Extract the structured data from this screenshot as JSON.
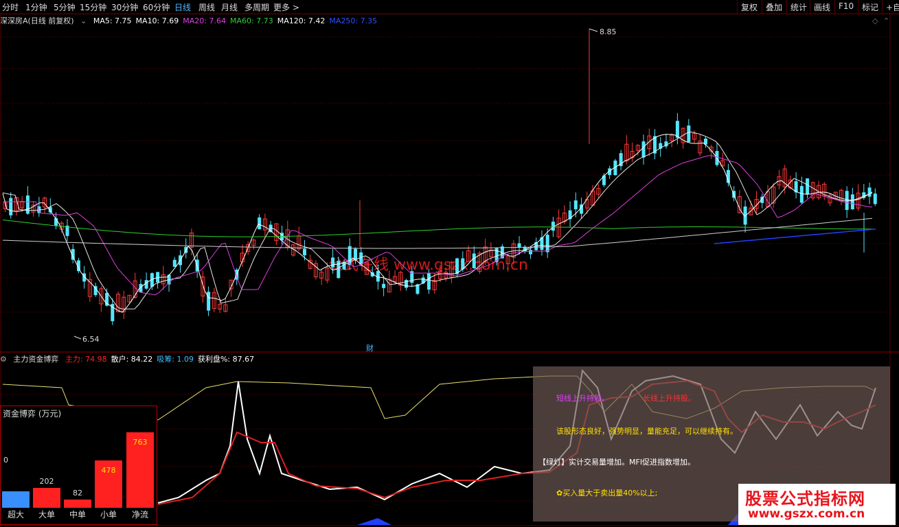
{
  "toolbar": {
    "periods": [
      "分时",
      "1分钟",
      "5分钟",
      "15分钟",
      "30分钟",
      "60分钟",
      "日线",
      "周线",
      "月线",
      "多周期",
      "更多 >"
    ],
    "active_period": "日线",
    "right_buttons": [
      "复权",
      "叠加",
      "统计",
      "画线",
      "F10",
      "标记",
      "+自"
    ]
  },
  "main_header": {
    "stock": "深深房A(日线 前复权)",
    "indicators": [
      {
        "label": "MA5: 7.75",
        "color": "#ffffff"
      },
      {
        "label": "MA10: 7.69",
        "color": "#ffffff"
      },
      {
        "label": "MA20: 7.64",
        "color": "#e040e0"
      },
      {
        "label": "MA60: 7.73",
        "color": "#30d030"
      },
      {
        "label": "MA120: 7.42",
        "color": "#ffffff"
      },
      {
        "label": "MA250: 7.35",
        "color": "#3050ff"
      }
    ]
  },
  "chart_annotations": {
    "high": "8.85",
    "low": "6.54",
    "marker": "财"
  },
  "sub_header": {
    "title": "主力资金博弈",
    "values": [
      {
        "label": "主力: 74.98",
        "color": "#ff2020"
      },
      {
        "label": "散户: 84.22",
        "color": "#ffffff"
      },
      {
        "label": "吸筹: 1.09",
        "color": "#40c0ff"
      },
      {
        "label": "获利盘%: 87.67",
        "color": "#ffffff"
      }
    ]
  },
  "fund_panel": {
    "title": "资金博弈 (万元)",
    "bars": [
      {
        "label": "超大",
        "value": 0,
        "color": "#3a8fff"
      },
      {
        "label": "大单",
        "value": 202,
        "color": "#ff2020"
      },
      {
        "label": "中单",
        "value": 82,
        "color": "#ff2020"
      },
      {
        "label": "小单",
        "value": 478,
        "color": "#ff2020"
      },
      {
        "label": "净流",
        "value": 763,
        "color": "#ff2020"
      }
    ]
  },
  "commentary": {
    "line1a": "短线上升持股。",
    "line1b": "长线上升持股。",
    "line2": "该股形态良好，强势明显，量能充足，可以继续持有。",
    "line3": "【绿灯】实计交易量增加。MFI促进指数增加。",
    "line4": "✿买入量大于卖出量40%以上;"
  },
  "watermarks": {
    "center": "公式在线 www.gszx.com.cn",
    "box_l1": "股票公式指标网",
    "box_l2": "www.gszx.com.cn"
  },
  "colors": {
    "up": "#ff3a3a",
    "down": "#54e6ff",
    "grid": "#7a0000"
  }
}
